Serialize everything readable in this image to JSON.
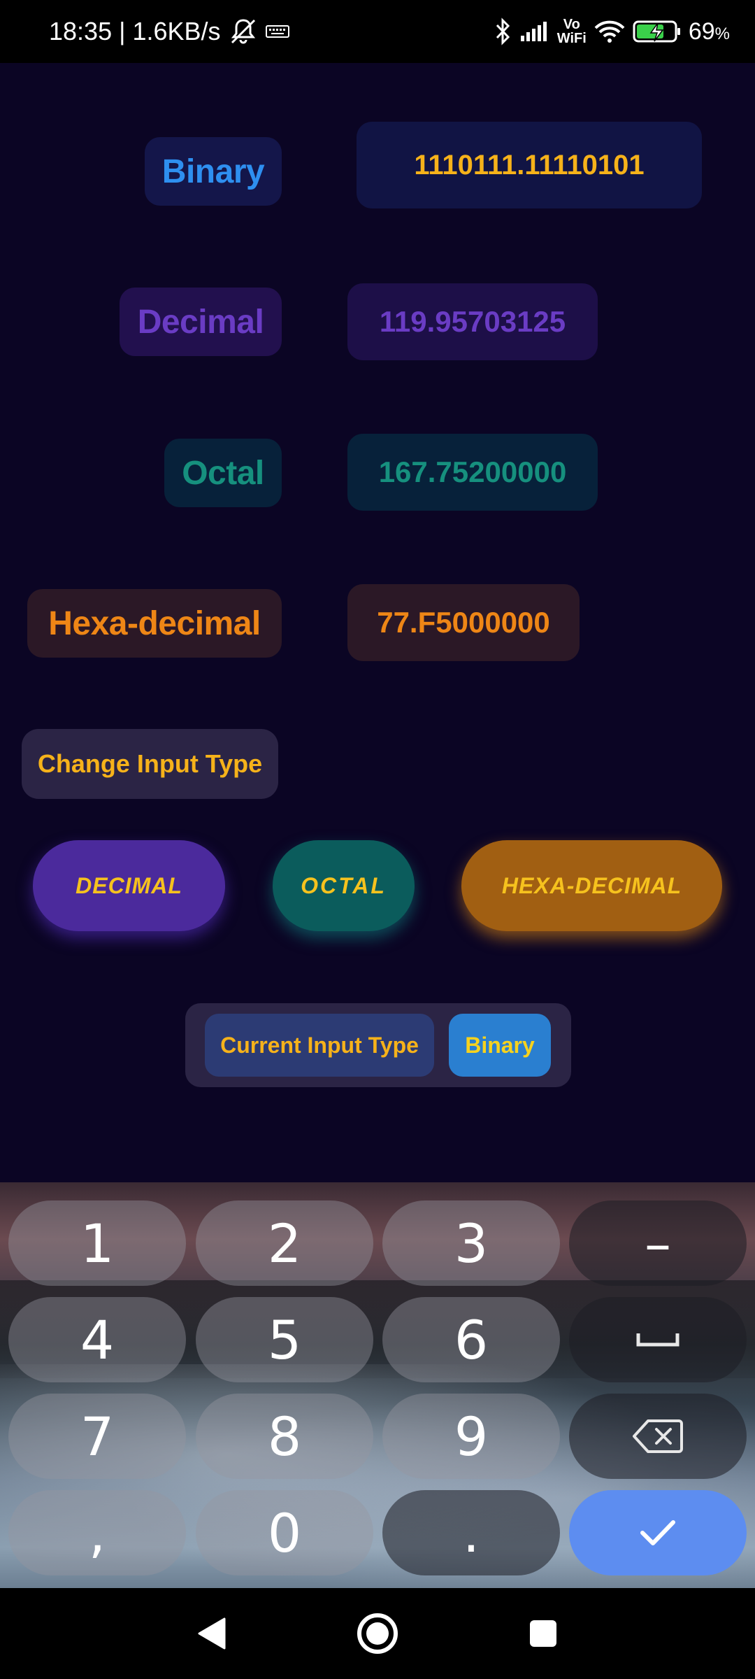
{
  "status_bar": {
    "left_text": "18:35 | 1.6KB/s",
    "battery_percent": "69",
    "battery_unit": "%",
    "icons": [
      "mute-bell-icon",
      "keyboard-icon",
      "bluetooth-icon",
      "signal-icon",
      "vowifi-icon",
      "wifi-icon",
      "battery-charging-icon"
    ],
    "vo": "Vo",
    "wifi": "WiFi"
  },
  "results": {
    "binary": {
      "label": "Binary",
      "value": "1110111.11110101"
    },
    "decimal": {
      "label": "Decimal",
      "value": "119.95703125"
    },
    "octal": {
      "label": "Octal",
      "value": "167.75200000"
    },
    "hex": {
      "label": "Hexa-decimal",
      "value": "77.F5000000"
    }
  },
  "change_input_type_label": "Change Input Type",
  "type_buttons": {
    "decimal": "DECIMAL",
    "octal": "OCTAL",
    "hex": "HEXA-DECIMAL"
  },
  "current": {
    "label": "Current Input Type",
    "value": "Binary"
  },
  "keyboard": {
    "keys": {
      "k1": "1",
      "k2": "2",
      "k3": "3",
      "minus": "–",
      "k4": "4",
      "k5": "5",
      "k6": "6",
      "k7": "7",
      "k8": "8",
      "k9": "9",
      "comma": ",",
      "k0": "0",
      "dot": "."
    }
  },
  "colors": {
    "background": "#0b0524",
    "accent_yellow": "#f6b21a",
    "binary_blue": "#2e8ff0",
    "decimal_purple": "#6a3cc4",
    "octal_teal": "#16907e",
    "hex_orange": "#ee8616",
    "enter_key": "#5d8df0"
  }
}
